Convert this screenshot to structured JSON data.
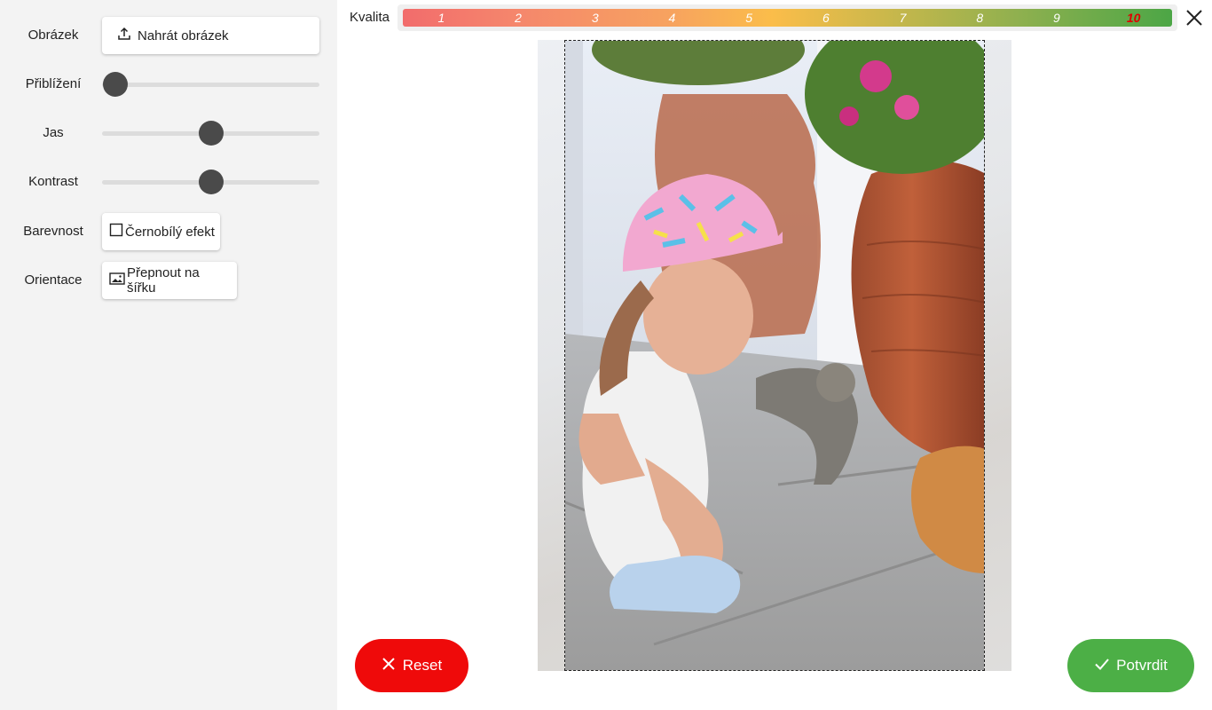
{
  "sidebar": {
    "image": {
      "label": "Obrázek",
      "upload_button": "Nahrát obrázek",
      "upload_icon": "upload-icon"
    },
    "zoom": {
      "label": "Přiblížení",
      "value_fraction": 0.06
    },
    "brightness": {
      "label": "Jas",
      "value_fraction": 0.5
    },
    "contrast": {
      "label": "Kontrast",
      "value_fraction": 0.5
    },
    "color": {
      "label": "Barevnost",
      "bw_button": "Černobílý efekt",
      "bw_checked": false,
      "icon": "checkbox-icon"
    },
    "orientation": {
      "label": "Orientace",
      "switch_button": "Přepnout na šířku",
      "icon": "image-icon"
    }
  },
  "quality": {
    "label": "Kvalita",
    "levels": [
      "1",
      "2",
      "3",
      "4",
      "5",
      "6",
      "7",
      "8",
      "9",
      "10"
    ],
    "selected": "10",
    "gradient_colors": [
      "#f26c6c",
      "#fbbd4a",
      "#4ca646"
    ],
    "selected_color": "#e00000"
  },
  "close": {
    "icon": "close-icon"
  },
  "actions": {
    "reset": {
      "label": "Reset",
      "icon": "close-icon",
      "color": "#ef0a0a"
    },
    "confirm": {
      "label": "Potvrdit",
      "icon": "check-icon",
      "color": "#4caf46"
    }
  }
}
